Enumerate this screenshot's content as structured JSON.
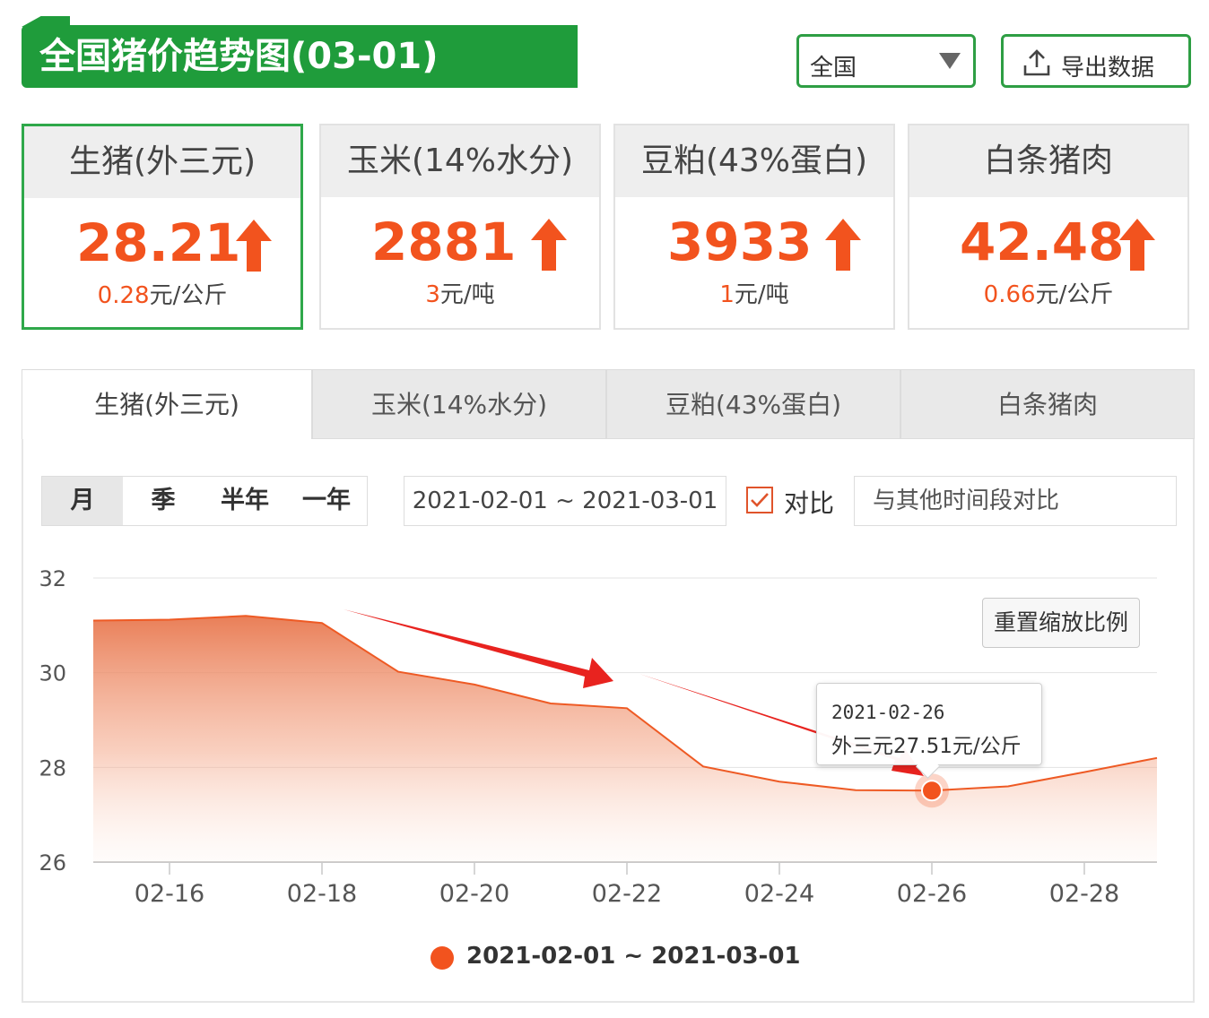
{
  "header": {
    "title": "全国猪价趋势图(03-01)",
    "region": "全国",
    "export_label": "导出数据"
  },
  "cards": [
    {
      "name": "生猪(外三元)",
      "price": "28.21",
      "change": "0.28",
      "unit": "元/公斤",
      "trend": "up"
    },
    {
      "name": "玉米(14%水分)",
      "price": "2881",
      "change": "3",
      "unit": "元/吨",
      "trend": "up"
    },
    {
      "name": "豆粕(43%蛋白)",
      "price": "3933",
      "change": "1",
      "unit": "元/吨",
      "trend": "up"
    },
    {
      "name": "白条猪肉",
      "price": "42.48",
      "change": "0.66",
      "unit": "元/公斤",
      "trend": "up"
    }
  ],
  "tabs": [
    "生猪(外三元)",
    "玉米(14%水分)",
    "豆粕(43%蛋白)",
    "白条猪肉"
  ],
  "controls": {
    "periods": [
      "月",
      "季",
      "半年",
      "一年"
    ],
    "active_period": "月",
    "date_range": "2021-02-01 ~ 2021-03-01",
    "compare_label": "对比",
    "compare_checked": true,
    "compare_placeholder": "与其他时间段对比",
    "reset_label": "重置缩放比例"
  },
  "tooltip": {
    "date": "2021-02-26",
    "value_text": "外三元27.51元/公斤"
  },
  "colors": {
    "brand_green": "#1f9c3b",
    "accent_orange": "#f2531e",
    "annotation_red": "#e8231f"
  },
  "chart_data": {
    "type": "area",
    "x": [
      "02-15",
      "02-16",
      "02-17",
      "02-18",
      "02-19",
      "02-20",
      "02-21",
      "02-22",
      "02-23",
      "02-24",
      "02-25",
      "02-26",
      "02-27",
      "02-28",
      "03-01"
    ],
    "x_ticks": [
      "02-16",
      "02-18",
      "02-20",
      "02-22",
      "02-24",
      "02-26",
      "02-28"
    ],
    "ylim": [
      26,
      32
    ],
    "y_ticks": [
      26,
      28,
      30,
      32
    ],
    "grid": true,
    "series": [
      {
        "name": "2021-02-01 ~ 2021-03-01",
        "values": [
          31.1,
          31.12,
          31.2,
          31.05,
          30.02,
          29.75,
          29.35,
          29.25,
          28.02,
          27.7,
          27.52,
          27.51,
          27.6,
          27.9,
          28.2
        ]
      }
    ],
    "highlight": {
      "x": "02-26",
      "y": 27.51
    }
  }
}
